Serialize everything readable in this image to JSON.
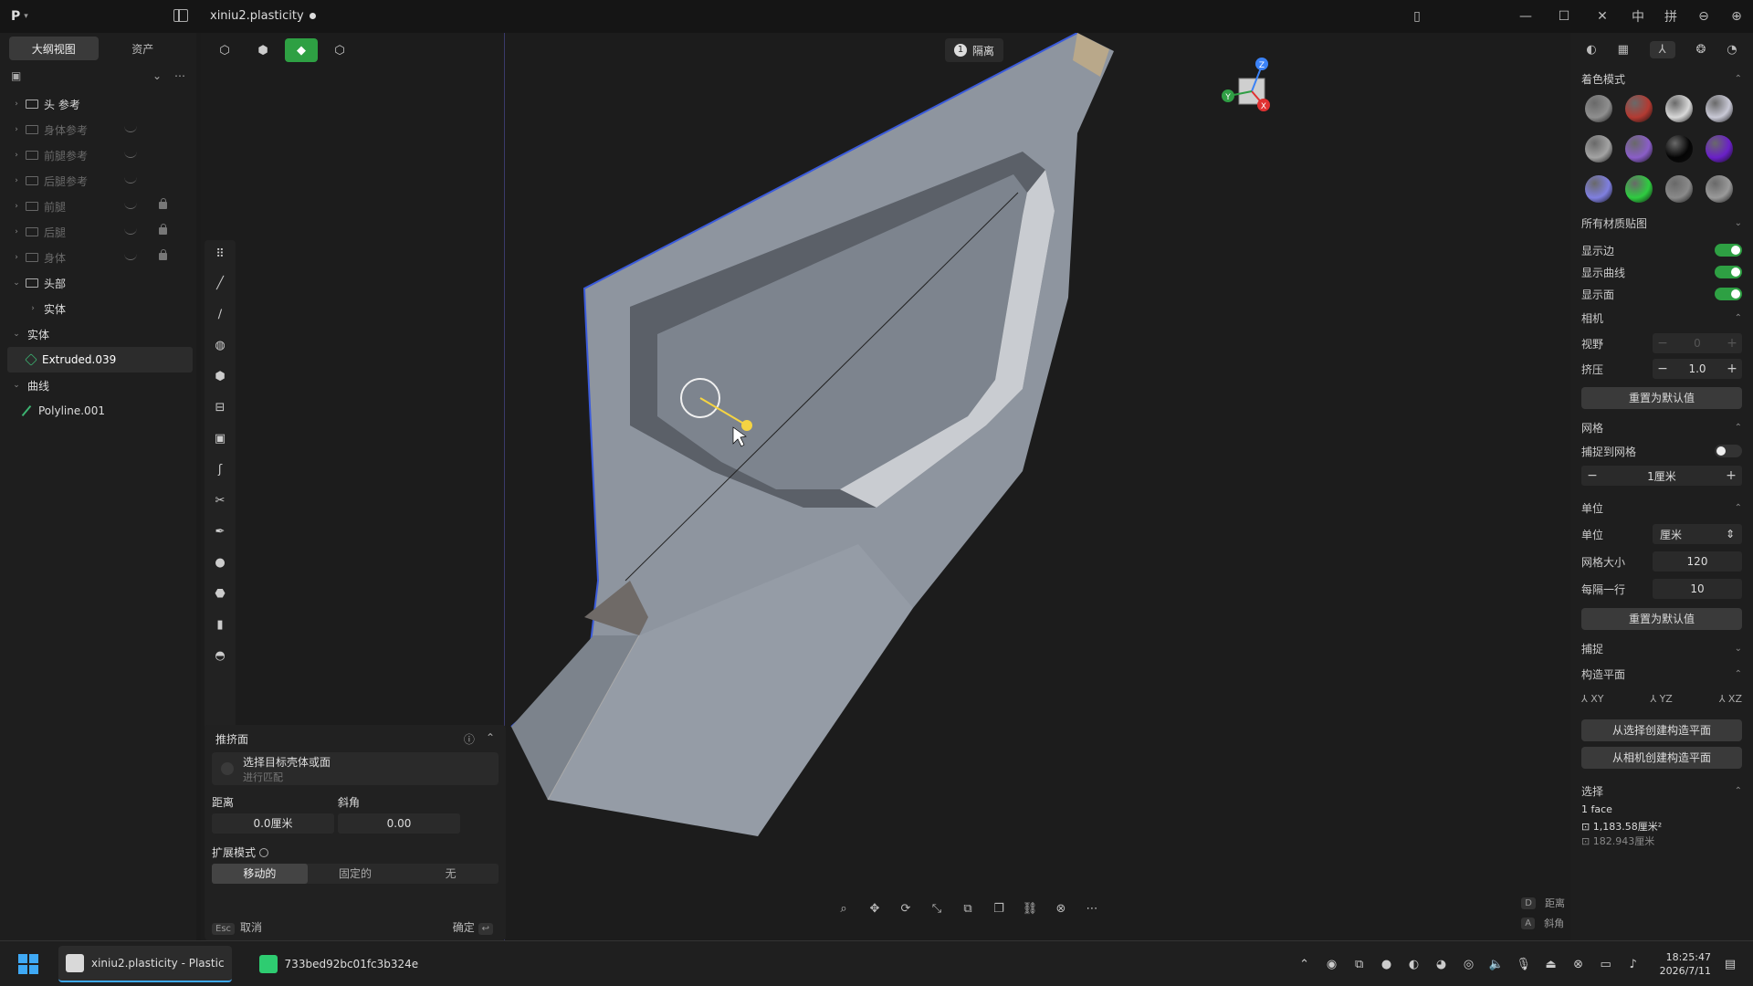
{
  "app": {
    "logo": "P",
    "file_title": "xiniu2.plasticity",
    "ime_labels": [
      "中",
      "拼"
    ]
  },
  "left_panel": {
    "tabs": [
      {
        "label": "大纲视图",
        "active": true
      },
      {
        "label": "资产",
        "active": false
      }
    ],
    "tree": [
      {
        "label": "头 参考",
        "type": "folder",
        "dim": false,
        "eye": false,
        "lock": false
      },
      {
        "label": "身体参考",
        "type": "folder",
        "dim": true,
        "eye": true,
        "lock": false
      },
      {
        "label": "前腿参考",
        "type": "folder",
        "dim": true,
        "eye": true,
        "lock": false
      },
      {
        "label": "后腿参考",
        "type": "folder",
        "dim": true,
        "eye": true,
        "lock": false
      },
      {
        "label": "前腿",
        "type": "folder",
        "dim": true,
        "eye": true,
        "lock": true
      },
      {
        "label": "后腿",
        "type": "folder",
        "dim": true,
        "eye": true,
        "lock": true
      },
      {
        "label": "身体",
        "type": "folder",
        "dim": true,
        "eye": true,
        "lock": true
      },
      {
        "label": "头部",
        "type": "folder",
        "dim": false,
        "eye": false,
        "lock": false
      },
      {
        "label": "实体",
        "type": "sub",
        "dim": false
      },
      {
        "label": "实体",
        "type": "group",
        "dim": false
      },
      {
        "label": "Extruded.039",
        "type": "solid",
        "dim": false
      },
      {
        "label": "曲线",
        "type": "group",
        "dim": false
      },
      {
        "label": "Polyline.001",
        "type": "curve",
        "dim": false
      }
    ]
  },
  "viewport": {
    "isolate_count": "1",
    "isolate_label": "隔离",
    "mode_buttons": [
      "vertex",
      "edge",
      "face",
      "solid"
    ],
    "extrude_panel": {
      "title": "推挤面",
      "target_title": "选择目标壳体或面",
      "target_sub": "进行匹配",
      "distance_label": "距离",
      "angle_label": "斜角",
      "distance_value": "0.0厘米",
      "angle_value": "0.00",
      "mode_label": "扩展模式",
      "modes": [
        "移动的",
        "固定的",
        "无"
      ],
      "active_mode": "移动的",
      "esc_key": "Esc",
      "cancel": "取消",
      "confirm": "确定",
      "enter_key": "↩"
    },
    "hints": [
      {
        "key": "D",
        "label": "距离"
      },
      {
        "key": "A",
        "label": "斜角"
      }
    ],
    "gizmo_axes": {
      "z": "Z",
      "y": "Y",
      "x": "X"
    }
  },
  "right_panel": {
    "shading": {
      "title": "着色模式",
      "materials": [
        "#8f8f8f",
        "#b33a32",
        "#d8d8d8",
        "#c9c9d6",
        "#a3a3a3",
        "#8a5ec8",
        "#050505",
        "#6a20c8",
        "#7f7fe0",
        "#2ecc40",
        "#8a8a8a",
        "#9a9a9a"
      ]
    },
    "all_textures": "所有材质贴图",
    "display": [
      {
        "label": "显示边",
        "on": true
      },
      {
        "label": "显示曲线",
        "on": true
      },
      {
        "label": "显示面",
        "on": true
      }
    ],
    "camera": {
      "title": "相机",
      "fov_label": "视野",
      "fov_value": "0",
      "squash_label": "挤压",
      "squash_value": "1.0",
      "reset": "重置为默认值"
    },
    "grid": {
      "title": "网格",
      "snap_label": "捕捉到网格",
      "snap_on": false,
      "step_value": "1厘米"
    },
    "units": {
      "title": "单位",
      "unit_label": "单位",
      "unit_value": "厘米",
      "grid_size_label": "网格大小",
      "grid_size_value": "120",
      "per_row_label": "每隔一行",
      "per_row_value": "10",
      "reset": "重置为默认值"
    },
    "snap": {
      "title": "捕捉"
    },
    "cplane": {
      "title": "构造平面",
      "planes": [
        "XY",
        "YZ",
        "XZ"
      ],
      "from_selection": "从选择创建构造平面",
      "from_camera": "从相机创建构造平面"
    },
    "selection": {
      "title": "选择",
      "count": "1 face",
      "area": "1,183.58厘米²",
      "area2": "182.943厘米"
    }
  },
  "taskbar": {
    "items": [
      {
        "label": "xiniu2.plasticity - Plastic",
        "active": true
      },
      {
        "label": "733bed92bc01fc3b324e",
        "active": false
      }
    ],
    "time": "18:25:47",
    "date": "2026/7/11"
  }
}
